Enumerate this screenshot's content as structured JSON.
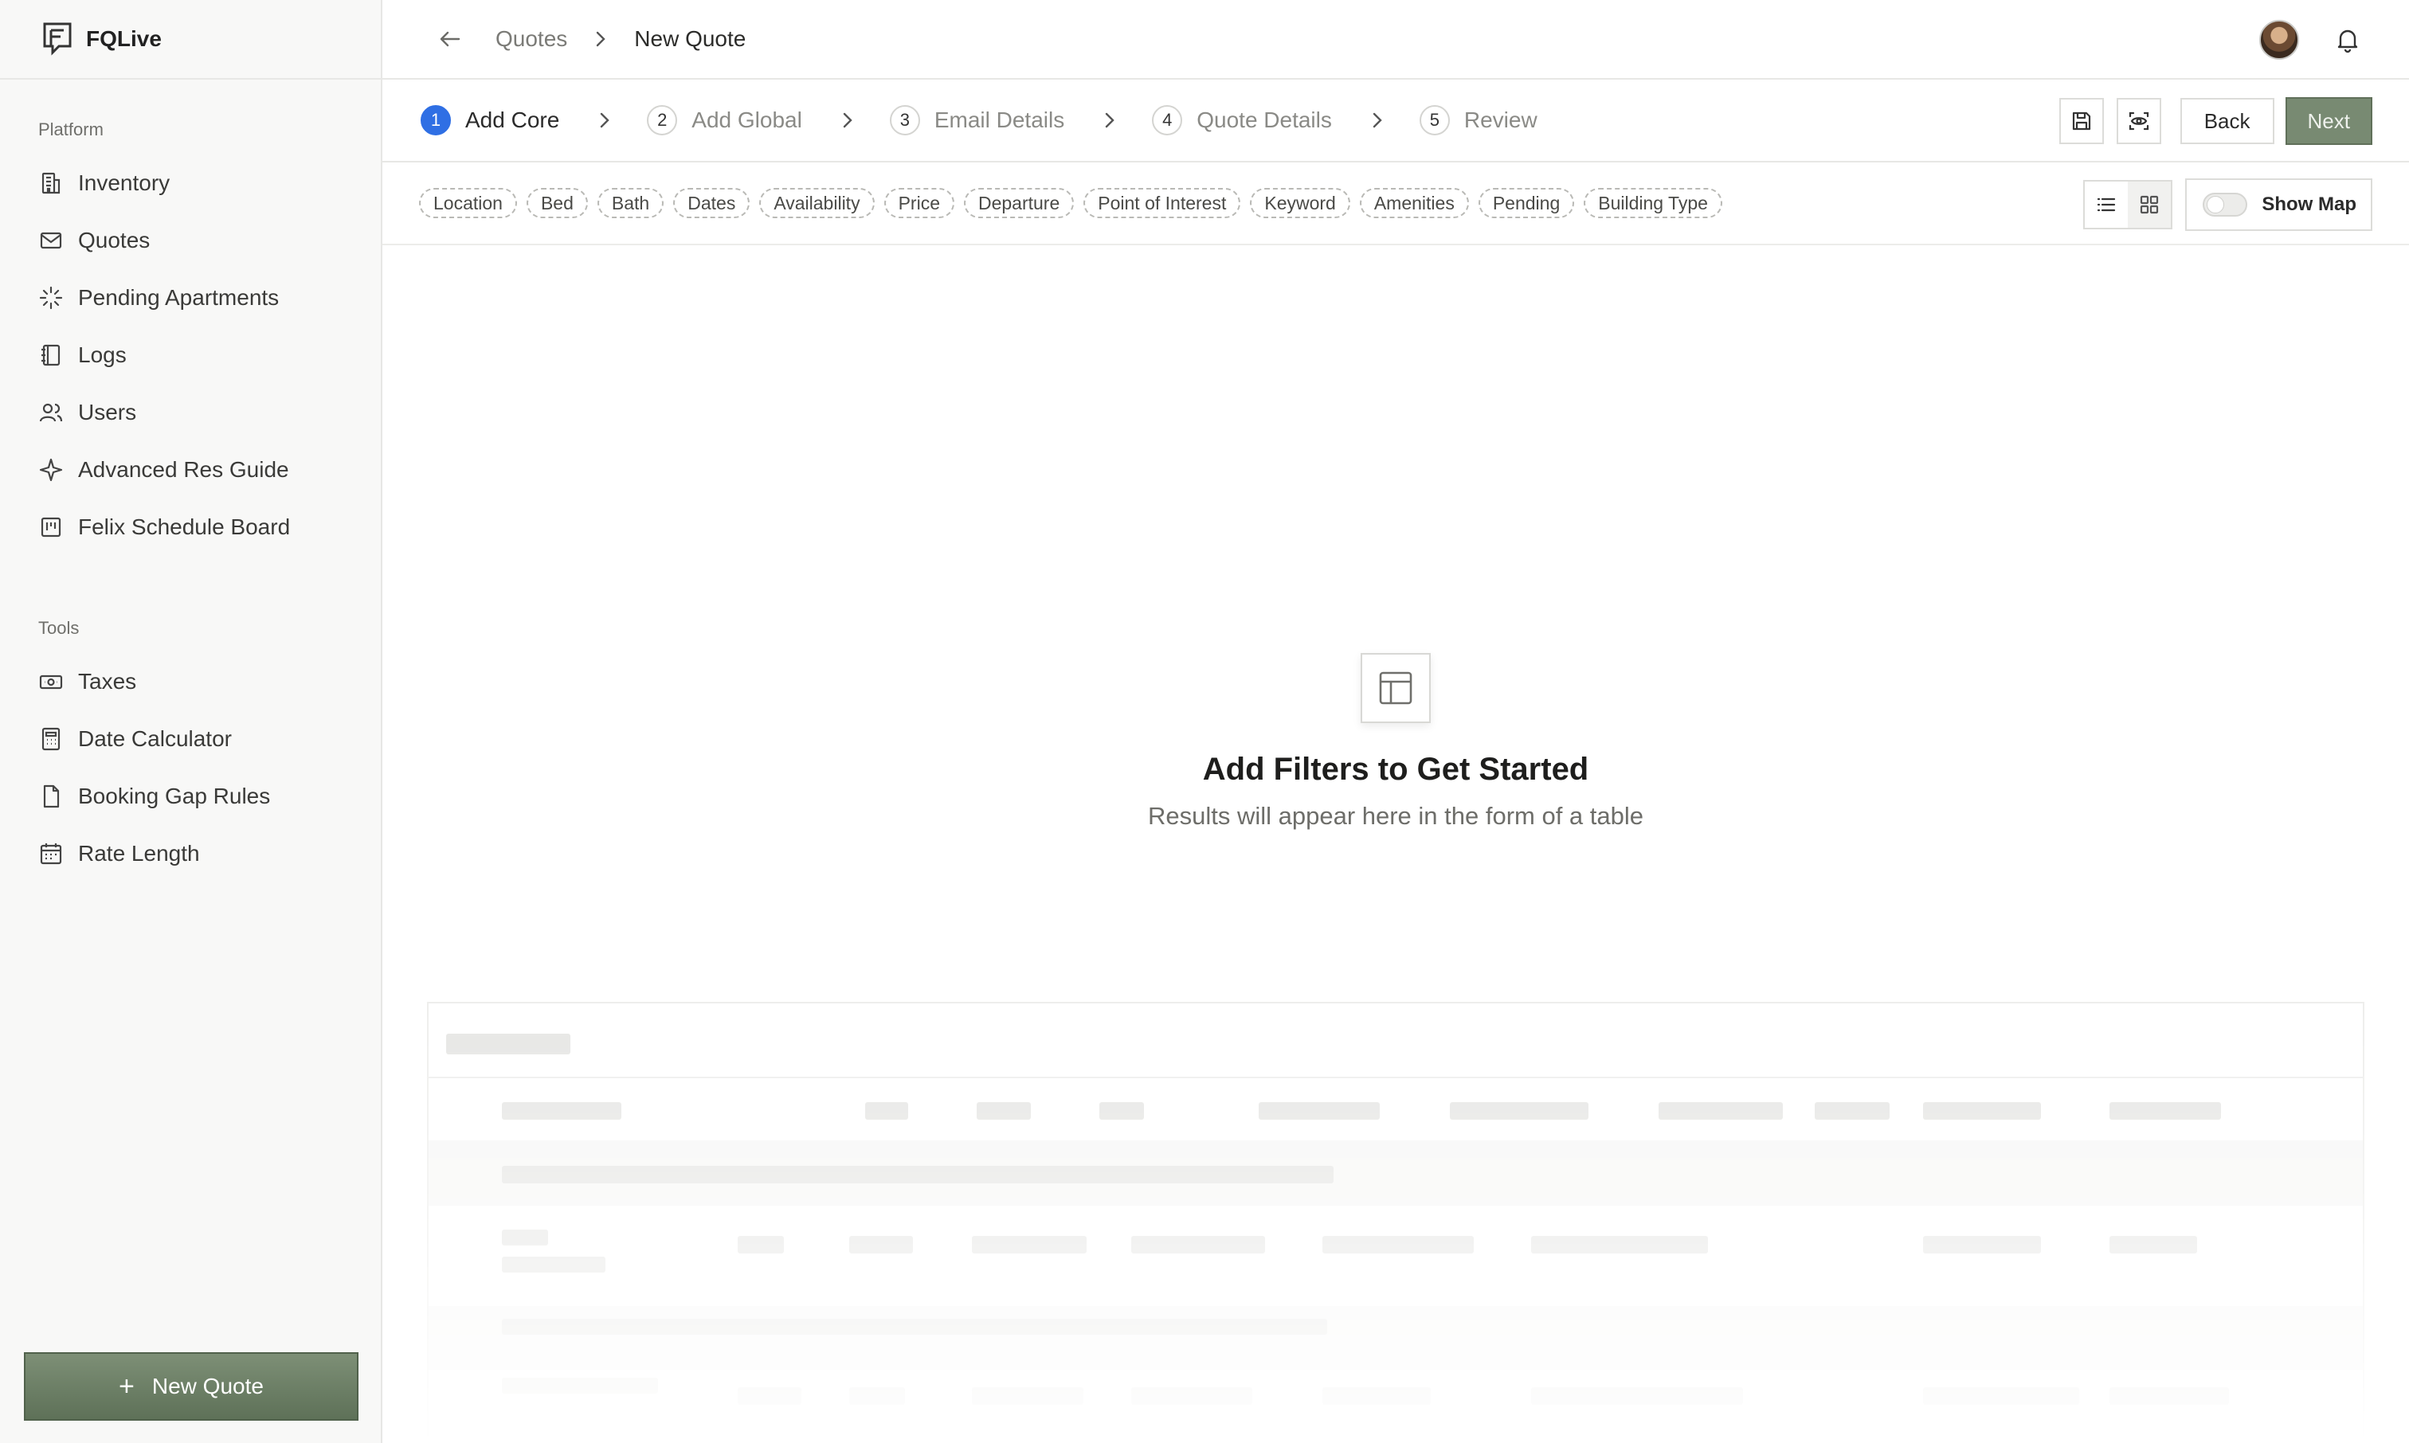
{
  "app": {
    "brand": "FQLive"
  },
  "sidebar": {
    "platform_title": "Platform",
    "platform_items": [
      {
        "label": "Inventory",
        "icon": "building-icon"
      },
      {
        "label": "Quotes",
        "icon": "mail-icon"
      },
      {
        "label": "Pending Apartments",
        "icon": "loader-icon"
      },
      {
        "label": "Logs",
        "icon": "notebook-icon"
      },
      {
        "label": "Users",
        "icon": "users-icon"
      },
      {
        "label": "Advanced Res Guide",
        "icon": "sparkle-icon"
      },
      {
        "label": "Felix Schedule Board",
        "icon": "kanban-icon"
      }
    ],
    "tools_title": "Tools",
    "tools_items": [
      {
        "label": "Taxes",
        "icon": "banknote-icon"
      },
      {
        "label": "Date Calculator",
        "icon": "calculator-icon"
      },
      {
        "label": "Booking Gap Rules",
        "icon": "file-icon"
      },
      {
        "label": "Rate Length",
        "icon": "calendar-icon"
      }
    ],
    "new_quote_label": "New Quote"
  },
  "header": {
    "breadcrumb": [
      "Quotes",
      "New Quote"
    ]
  },
  "stepper": {
    "steps": [
      {
        "num": "1",
        "label": "Add Core",
        "active": true
      },
      {
        "num": "2",
        "label": "Add Global",
        "active": false
      },
      {
        "num": "3",
        "label": "Email Details",
        "active": false
      },
      {
        "num": "4",
        "label": "Quote Details",
        "active": false
      },
      {
        "num": "5",
        "label": "Review",
        "active": false
      }
    ],
    "back_label": "Back",
    "next_label": "Next"
  },
  "filters": {
    "chips": [
      "Location",
      "Bed",
      "Bath",
      "Dates",
      "Availability",
      "Price",
      "Departure",
      "Point of Interest",
      "Keyword",
      "Amenities",
      "Pending",
      "Building Type"
    ],
    "show_map_label": "Show Map",
    "show_map_on": false
  },
  "empty_state": {
    "title": "Add Filters to Get Started",
    "subtitle": "Results will appear here in the form of a table"
  },
  "colors": {
    "accent_green": "#788a72",
    "active_step_blue": "#2f6fe4"
  }
}
